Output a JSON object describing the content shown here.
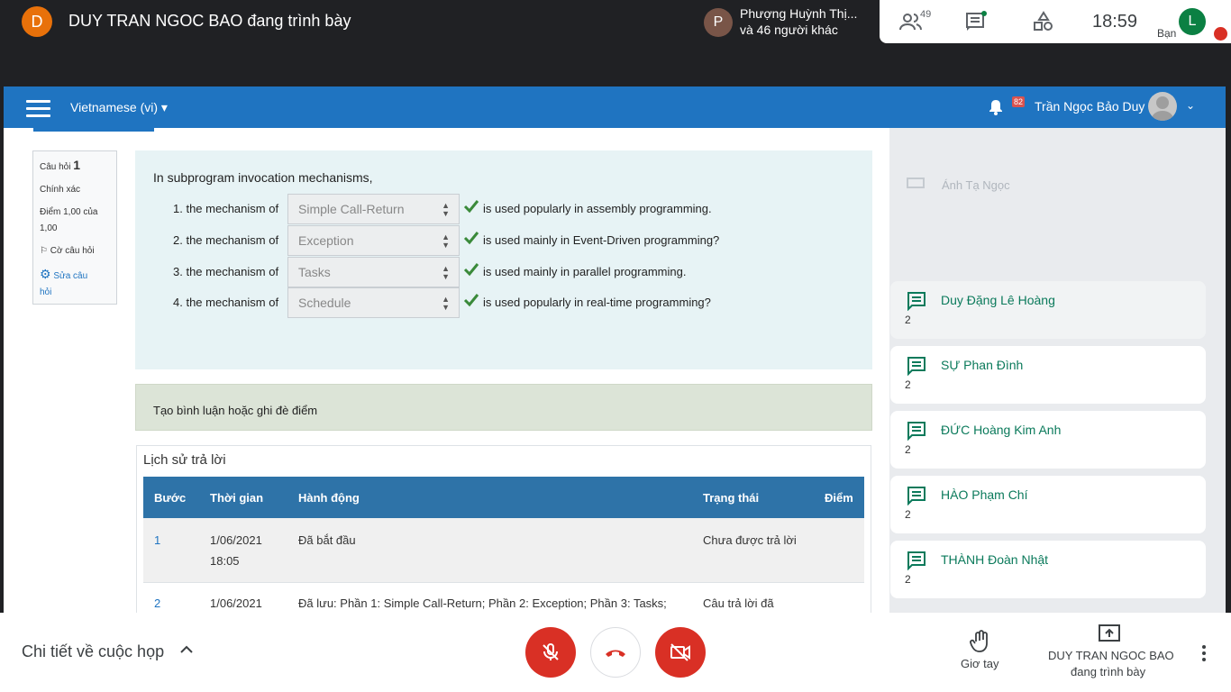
{
  "meet": {
    "presenter_initial": "D",
    "presenter_title": "DUY TRAN NGOC BAO đang trình bày",
    "participants": {
      "avatar_initial": "P",
      "line1": "Phượng Huỳnh Thị...",
      "line2": "và 46 người khác"
    },
    "people_count": "49",
    "time": "18:59",
    "me_initial": "L",
    "me_label": "Bạn",
    "meeting_details": "Chi tiết về cuộc họp",
    "raise_hand_label": "Giơ tay",
    "presenting_line1": "DUY TRAN NGOC BAO",
    "presenting_line2": "đang trình bày",
    "icons": [
      "people-icon",
      "chat-icon",
      "activities-icon",
      "mic-off-icon",
      "hangup-icon",
      "camera-off-icon",
      "hand-icon",
      "present-icon",
      "more-vert-icon"
    ],
    "colors": {
      "red": "#d93025",
      "green": "#0b8043",
      "orange": "#e8710a"
    }
  },
  "moodle": {
    "language": "Vietnamese (vi)",
    "notifications": "82",
    "user_name": "Trần Ngọc Bảo Duy",
    "nav_color": "#1f74c1",
    "question_info": {
      "label": "Câu hỏi",
      "number": "1",
      "status": "Chính xác",
      "score_line1": "Điểm 1,00 của",
      "score_line2": "1,00",
      "flag": "Cờ câu hỏi",
      "edit_line1": "Sửa câu",
      "edit_line2": "hỏi"
    },
    "question_text": "In subprogram invocation mechanisms,",
    "rows": [
      {
        "prefix": "1. the mechanism of",
        "selected": "Simple Call-Return",
        "suffix": "is used popularly in assembly programming."
      },
      {
        "prefix": "2. the mechanism of",
        "selected": "Exception",
        "suffix": "is used mainly in Event-Driven programming?"
      },
      {
        "prefix": "3. the mechanism of",
        "selected": "Tasks",
        "suffix": "is used mainly in parallel programming."
      },
      {
        "prefix": "4. the mechanism of",
        "selected": "Schedule",
        "suffix": "is used popularly in real-time programming?"
      }
    ],
    "comment_link": "Tạo bình luận hoặc ghi đè điểm",
    "history": {
      "title": "Lịch sử trả lời",
      "headers": [
        "Bước",
        "Thời gian",
        "Hành động",
        "Trạng thái",
        "Điểm"
      ],
      "rows": [
        {
          "step": "1",
          "date": "1/06/2021",
          "time": "18:05",
          "action": "Đã bắt đầu",
          "status": "Chưa được trả lời"
        },
        {
          "step": "2",
          "date": "1/06/2021",
          "action": "Đã lưu: Phần 1: Simple Call-Return; Phần 2: Exception; Phần 3: Tasks;",
          "status": "Câu trả lời đã"
        }
      ]
    }
  },
  "chat_list": {
    "faded_name": "Ánh Tạ Ngọc",
    "items": [
      {
        "name": "Duy Đặng Lê Hoàng",
        "count": "2"
      },
      {
        "name": "SỰ Phan Đình",
        "count": "2"
      },
      {
        "name": "ĐỨC Hoàng Kim Anh",
        "count": "2"
      },
      {
        "name": "HÀO Phạm Chí",
        "count": "2"
      },
      {
        "name": "THÀNH Đoàn Nhật",
        "count": "2"
      }
    ]
  }
}
